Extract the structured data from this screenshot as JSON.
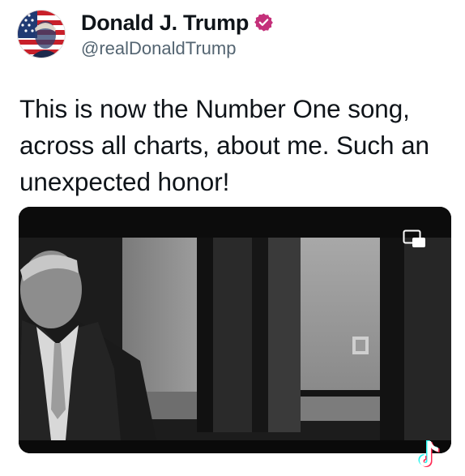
{
  "tweet": {
    "display_name": "Donald J. Trump",
    "handle": "@realDonaldTrump",
    "text": "This is now the Number One song, across all charts, about me. Such an unexpected honor!"
  },
  "icons": {
    "verified": "verified-badge-icon",
    "pip": "picture-in-picture-icon",
    "watermark": "tiktok-logo-icon"
  },
  "colors": {
    "verified_badge": "#c4307a",
    "handle": "#536471",
    "text": "#0f1419",
    "media_background": "#0c0c0c"
  }
}
